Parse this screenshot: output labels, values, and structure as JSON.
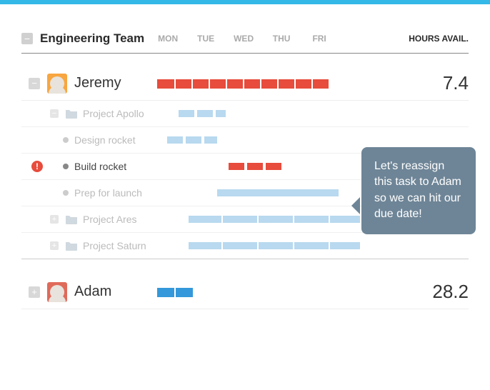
{
  "team": {
    "name": "Engineering Team",
    "hours_label": "HOURS AVAIL."
  },
  "days": [
    "MON",
    "TUE",
    "WED",
    "THU",
    "FRI"
  ],
  "people": [
    {
      "name": "Jeremy",
      "hours": "7.4"
    },
    {
      "name": "Adam",
      "hours": "28.2"
    }
  ],
  "tasks": {
    "apollo": "Project Apollo",
    "design": "Design rocket",
    "build": "Build rocket",
    "prep": "Prep for launch",
    "ares": "Project Ares",
    "saturn": "Project Saturn"
  },
  "tooltip": "Let's reassign this task to Adam so we can hit our due date!"
}
